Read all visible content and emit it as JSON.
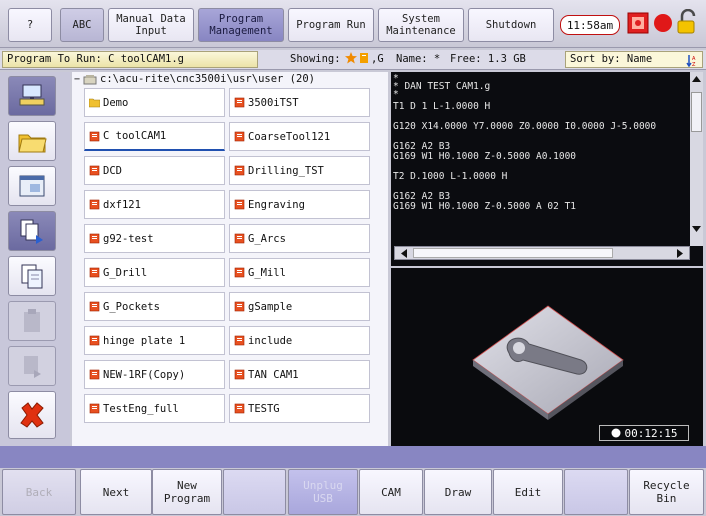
{
  "top_bar": {
    "help_label": "?",
    "abc_label": "ABC",
    "manual_label": "Manual Data\nInput",
    "program_mgmt_label": "Program\nManagement",
    "program_run_label": "Program Run",
    "system_label": "System\nMaintenance",
    "shutdown_label": "Shutdown",
    "clock": "11:58am"
  },
  "status": {
    "program_to_run": "Program To Run: C toolCAM1.g",
    "showing_label": "Showing:",
    "showing_suffix": ",G",
    "name_filter": "Name: *",
    "free_space": "Free: 1.3 GB",
    "sort_by": "Sort by: Name"
  },
  "browser": {
    "path": "c:\\acu-rite\\cnc3500i\\usr\\user (20)",
    "files": [
      {
        "name": "Demo",
        "icon": "folder"
      },
      {
        "name": "3500iTST",
        "icon": "file"
      },
      {
        "name": "C toolCAM1",
        "icon": "file"
      },
      {
        "name": "CoarseTool121",
        "icon": "file"
      },
      {
        "name": "DCD",
        "icon": "file"
      },
      {
        "name": "Drilling_TST",
        "icon": "file"
      },
      {
        "name": "dxf121",
        "icon": "file"
      },
      {
        "name": "Engraving",
        "icon": "file"
      },
      {
        "name": "g92-test",
        "icon": "file"
      },
      {
        "name": "G_Arcs",
        "icon": "file"
      },
      {
        "name": "G_Drill",
        "icon": "file"
      },
      {
        "name": "G_Mill",
        "icon": "file"
      },
      {
        "name": "G_Pockets",
        "icon": "file"
      },
      {
        "name": "gSample",
        "icon": "file"
      },
      {
        "name": "hinge plate 1",
        "icon": "file"
      },
      {
        "name": "include",
        "icon": "file"
      },
      {
        "name": "NEW-1RF(Copy)",
        "icon": "file"
      },
      {
        "name": "TAN CAM1",
        "icon": "file"
      },
      {
        "name": "TestEng_full",
        "icon": "file"
      },
      {
        "name": "TESTG",
        "icon": "file"
      }
    ]
  },
  "editor": {
    "lines": [
      "*",
      "* DAN TEST CAM1.g",
      "*",
      "T1 D 1 L-1.0000 H",
      "G120 X14.0000 Y7.0000 Z0.0000 I0.0000 J-5.0000",
      "G162 A2 B3",
      "G169 W1 H0.1000 Z-0.5000 A0.1000",
      "T2 D.1000 L-1.0000 H",
      "G162 A2 B3",
      "G169 W1 H0.1000 Z-0.5000 A 02 T1"
    ]
  },
  "preview": {
    "timer": "00:12:15"
  },
  "bottom_bar": {
    "back_label": "Back",
    "next_label": "Next",
    "new_program_label": "New\nProgram",
    "unplug_usb_label": "Unplug\nUSB",
    "cam_label": "CAM",
    "draw_label": "Draw",
    "edit_label": "Edit",
    "recycle_label": "Recycle\nBin"
  },
  "colors": {
    "accent": "#8886c2",
    "editor_bg": "#0b0c10",
    "alert_red": "#e02020",
    "lock_yellow": "#f4c300"
  }
}
